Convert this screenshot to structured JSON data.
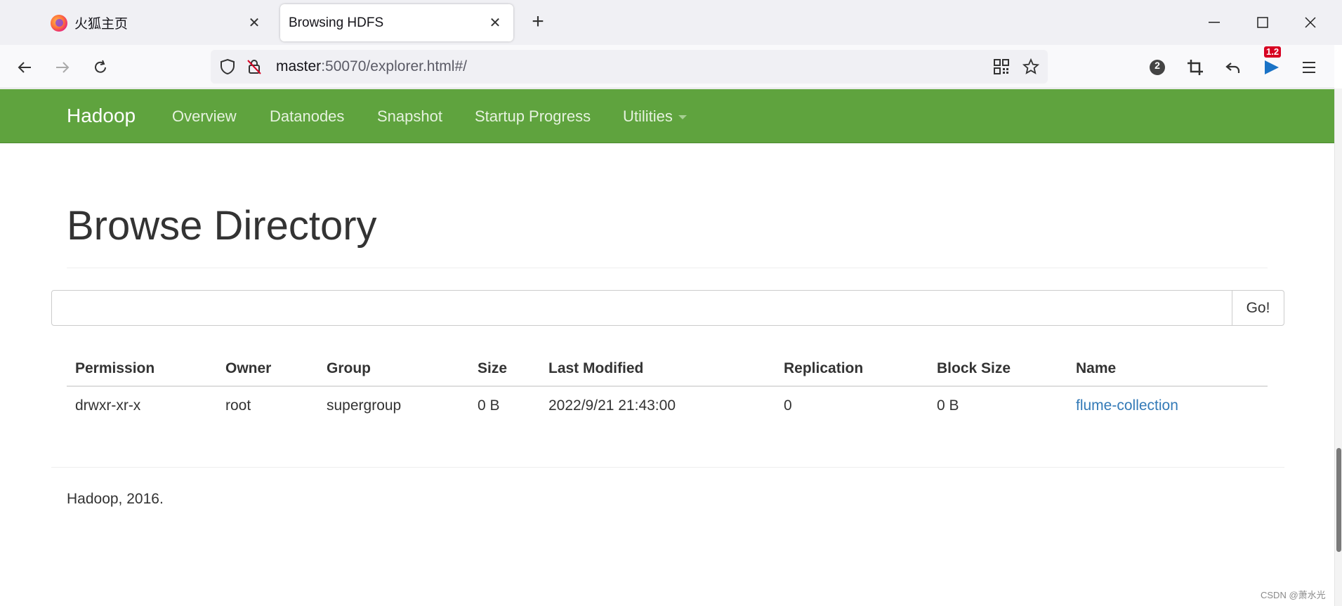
{
  "browser": {
    "tabs": [
      {
        "title": "火狐主页",
        "active": false
      },
      {
        "title": "Browsing HDFS",
        "active": true
      }
    ],
    "url": {
      "host": "master",
      "rest": ":50070/explorer.html#/"
    },
    "extension_badge": "1.2",
    "container_badge": "2"
  },
  "hadoop": {
    "brand": "Hadoop",
    "nav": [
      "Overview",
      "Datanodes",
      "Snapshot",
      "Startup Progress",
      "Utilities"
    ],
    "page_title": "Browse Directory",
    "path_input_value": "",
    "go_label": "Go!",
    "table": {
      "headers": [
        "Permission",
        "Owner",
        "Group",
        "Size",
        "Last Modified",
        "Replication",
        "Block Size",
        "Name"
      ],
      "rows": [
        [
          "drwxr-xr-x",
          "root",
          "supergroup",
          "0 B",
          "2022/9/21 21:43:00",
          "0",
          "0 B",
          "flume-collection"
        ]
      ]
    },
    "footer": "Hadoop, 2016."
  },
  "watermark": "CSDN @萧水光",
  "colors": {
    "navbar": "#5fa33e",
    "link": "#337ab7"
  }
}
